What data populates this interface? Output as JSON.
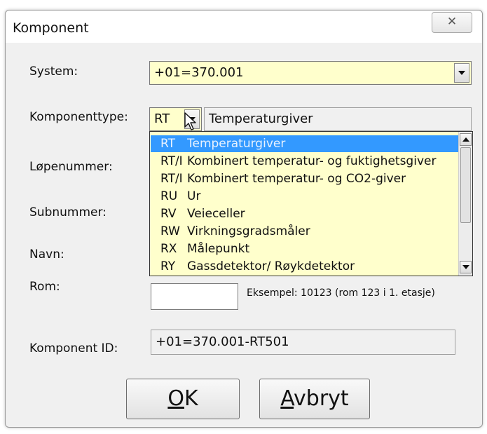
{
  "window": {
    "title": "Komponent",
    "close_glyph": "✕"
  },
  "labels": {
    "system": "System:",
    "komponenttype": "Komponenttype:",
    "lopenummer": "Løpenummer:",
    "subnummer": "Subnummer:",
    "navn": "Navn:",
    "rom": "Rom:",
    "komponent_id": "Komponent ID:"
  },
  "fields": {
    "system_value": "+01=370.001",
    "type_code": "RT",
    "type_description": "Temperaturgiver",
    "rom_value": "",
    "komponent_id_value": "+01=370.001-RT501"
  },
  "dropdown": {
    "items": [
      {
        "code": "RT",
        "name": "Temperaturgiver",
        "selected": true
      },
      {
        "code": "RT/I",
        "name": "Kombinert temperatur- og fuktighetsgiver"
      },
      {
        "code": "RT/I",
        "name": "Kombinert temperatur- og CO2-giver"
      },
      {
        "code": "RU",
        "name": "Ur"
      },
      {
        "code": "RV",
        "name": "Veieceller"
      },
      {
        "code": "RW",
        "name": "Virkningsgradsmåler"
      },
      {
        "code": "RX",
        "name": "Målepunkt"
      },
      {
        "code": "RY",
        "name": "Gassdetektor/ Røykdetektor"
      }
    ]
  },
  "hint": "Eksempel: 10123 (rom 123 i 1. etasje)",
  "buttons": {
    "ok_mnemonic": "O",
    "ok_rest": "K",
    "cancel_mnemonic": "A",
    "cancel_rest": "vbryt"
  },
  "colors": {
    "field_yellow": "#ffffcc",
    "selection_blue": "#3399ff"
  }
}
